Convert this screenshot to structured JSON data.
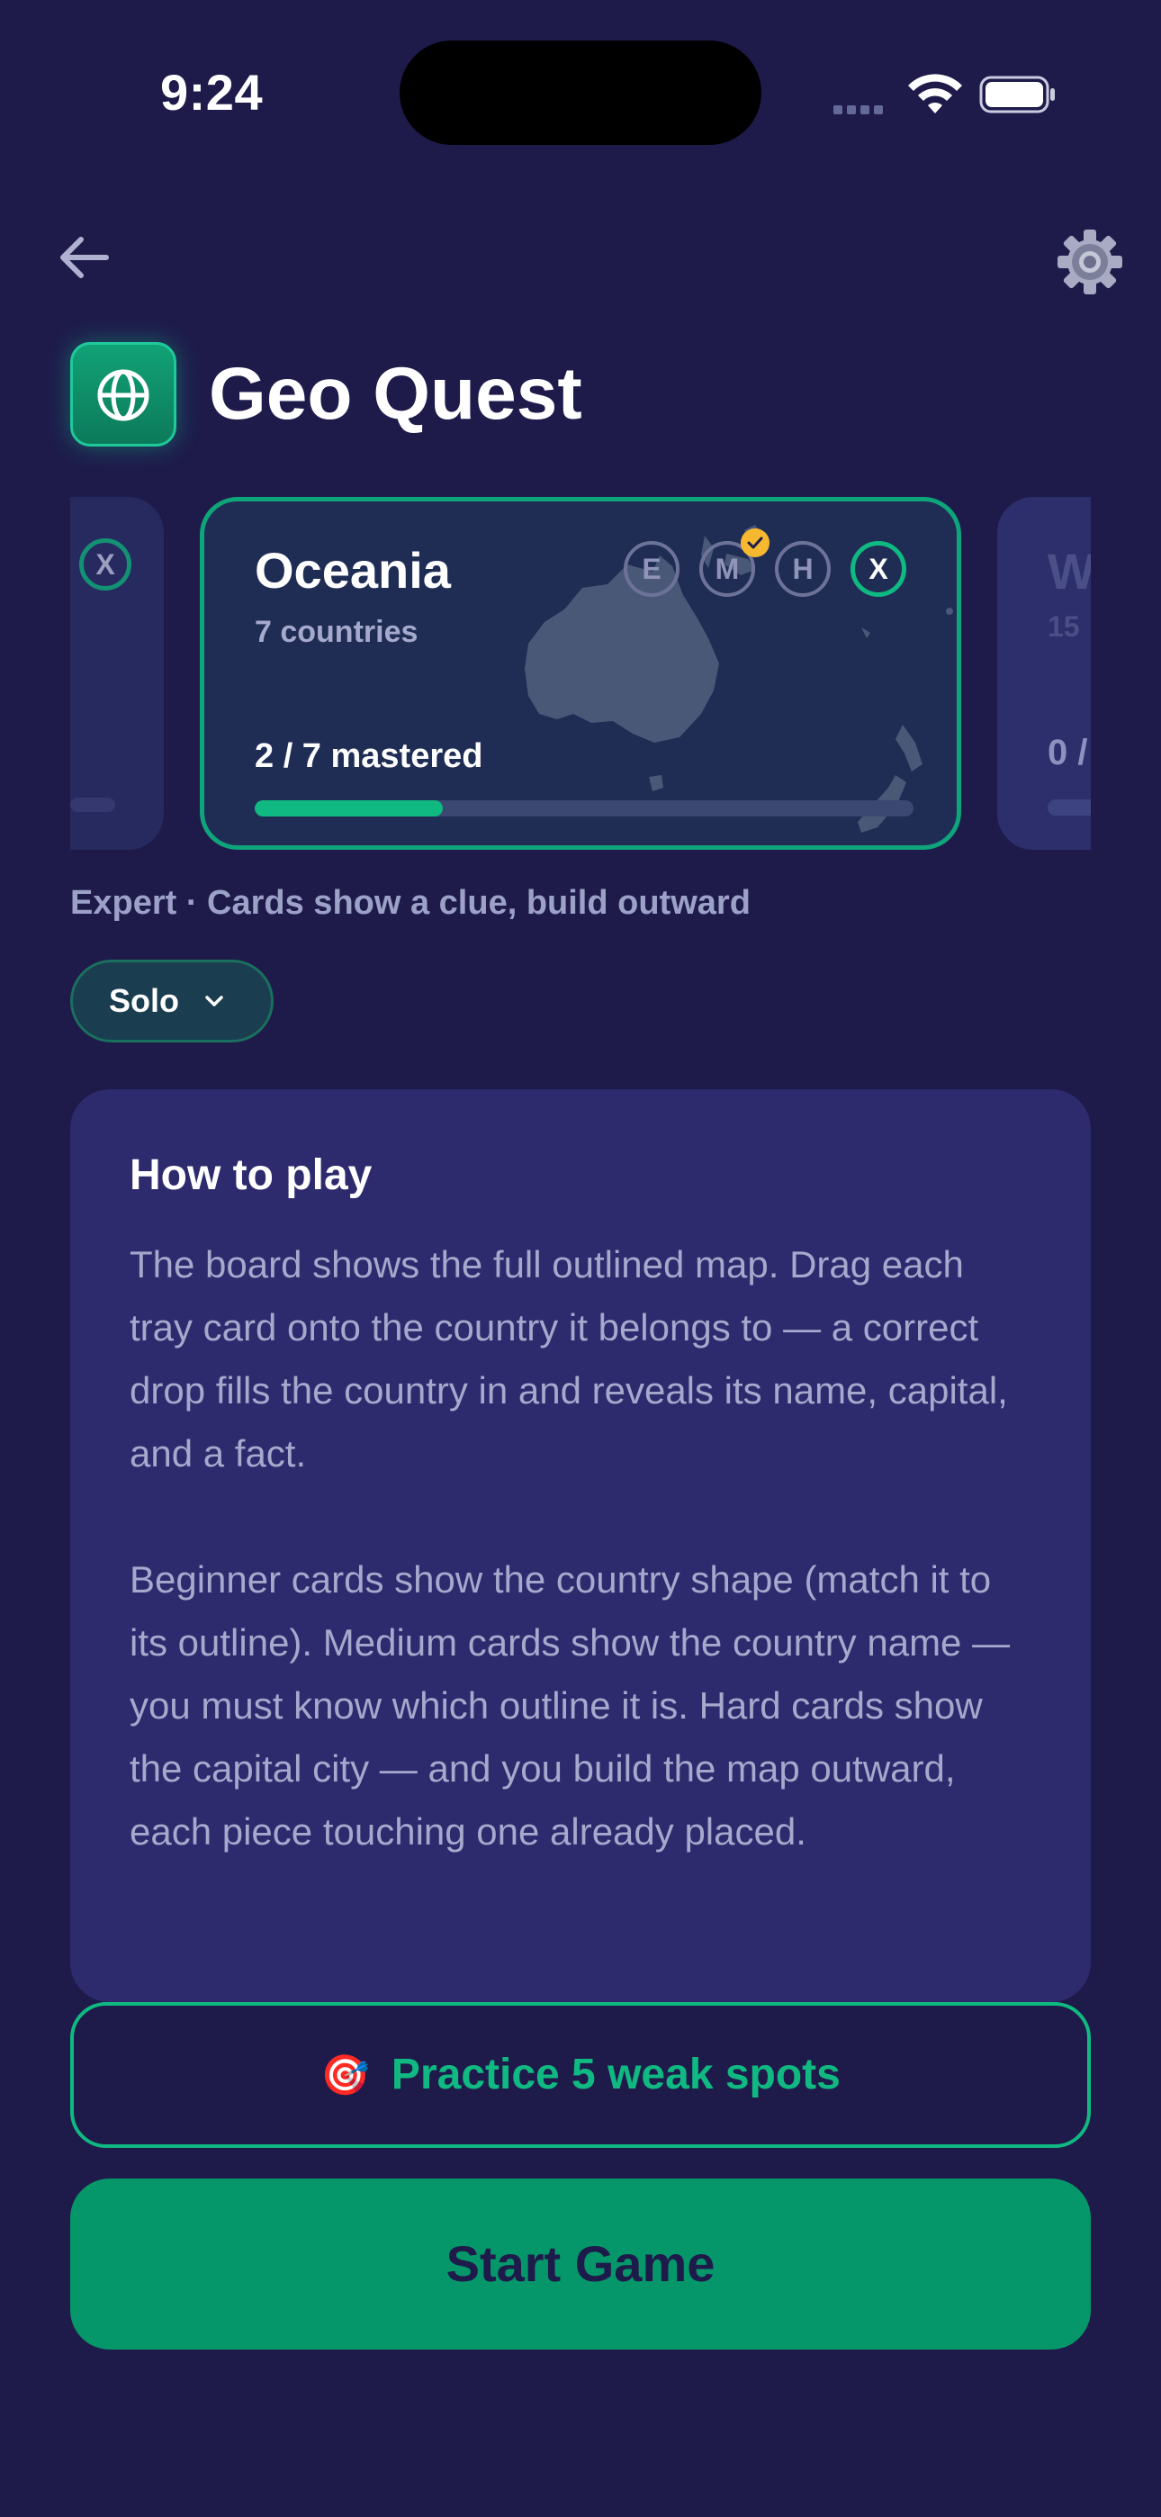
{
  "status_bar": {
    "time": "9:24"
  },
  "header": {
    "title": "Geo Quest"
  },
  "cards": {
    "left_peek": {
      "difficulty_badge": "X"
    },
    "current": {
      "name": "Oceania",
      "count": "7 countries",
      "mastered": "2 / 7 mastered",
      "progress_fraction": 0.286,
      "difficulties": [
        "E",
        "M",
        "H",
        "X"
      ],
      "selected_difficulty": "X",
      "completed_difficulty": "M"
    },
    "right_peek": {
      "name": "W",
      "count": "15",
      "mastered": "0 /"
    }
  },
  "mode_description": "Expert · Cards show a clue, build outward",
  "player_mode": {
    "label": "Solo"
  },
  "how_to_play": {
    "heading": "How to play",
    "paragraph1": "The board shows the full outlined map. Drag each tray card onto the country it belongs to — a correct drop fills the country in and reveals its name, capital, and a fact.",
    "paragraph2": "Beginner cards show the country shape (match it to its outline). Medium cards show the country name — you must know which outline it is. Hard cards show the capital city — and you build the map outward, each piece touching one already placed."
  },
  "practice_button": {
    "emoji": "🎯",
    "label": "Practice 5 weak spots"
  },
  "start_button": {
    "label": "Start Game"
  },
  "colors": {
    "background": "#1e1b4b",
    "accent": "#10b981",
    "check_badge": "#f5b82e"
  },
  "icons": [
    "back-arrow-icon",
    "gear-icon",
    "globe-icon",
    "check-icon",
    "chevron-down-icon",
    "wifi-icon",
    "battery-icon",
    "target-icon"
  ]
}
